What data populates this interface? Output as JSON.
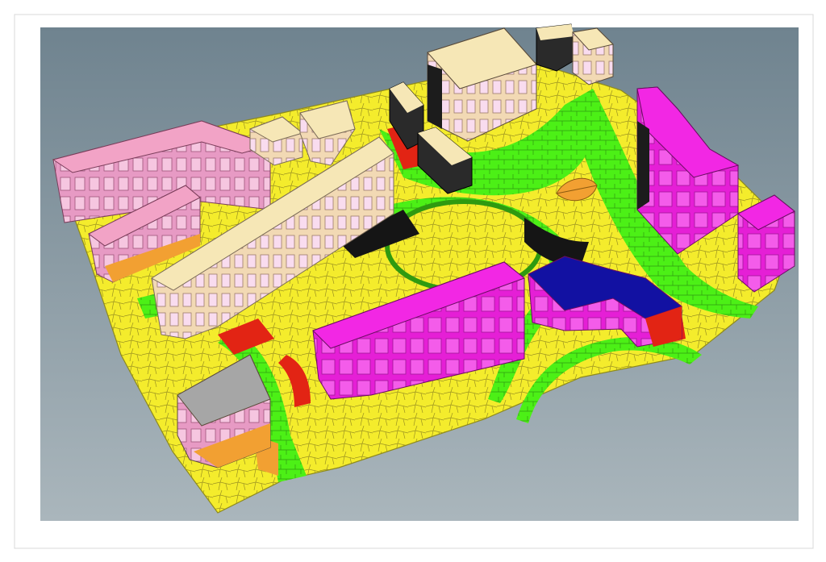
{
  "image": {
    "subject": "3d-urban-block-model",
    "colors": {
      "frame": "#ffffff",
      "sky_top": "#6f838f",
      "sky_bottom": "#a8b4bb",
      "ground_yellow": "#f4ec2c",
      "path_green": "#4cf016",
      "shadow_red": "#e22414",
      "shadow_black": "#151515",
      "magenta": "#f227e4",
      "pink": "#f2a3c6",
      "cream": "#f6e7b6",
      "blue_roof": "#1211a2",
      "grey_roof": "#a6a6a6",
      "orange": "#f2a032"
    }
  }
}
